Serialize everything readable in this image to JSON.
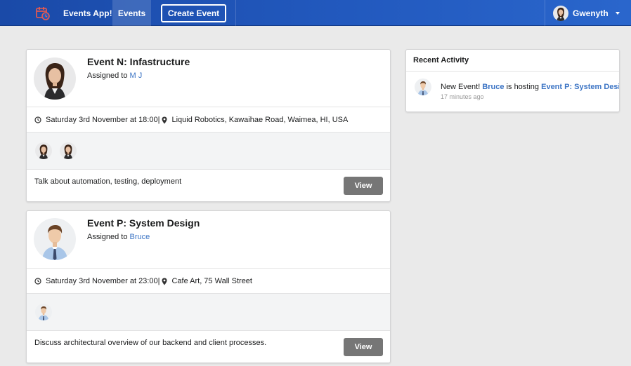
{
  "nav": {
    "brand": "Events App!",
    "events_tab": "Events",
    "create_button": "Create Event",
    "user_name": "Gwenyth",
    "brand_icon": "calendar-clock-icon"
  },
  "events": [
    {
      "title": "Event N: Infastructure",
      "assigned_prefix": "Assigned to",
      "assignee": "M J",
      "datetime": "Saturday 3rd November at 18:00|",
      "location": "Liquid Robotics, Kawaihae Road, Waimea, HI, USA",
      "description": "Talk about automation, testing, deployment",
      "view_label": "View"
    },
    {
      "title": "Event P: System Design",
      "assigned_prefix": "Assigned to",
      "assignee": "Bruce",
      "datetime": "Saturday 3rd November at 23:00|",
      "location": "Cafe Art, 75 Wall Street",
      "description": "Discuss architectural overview of our backend and client processes.",
      "view_label": "View"
    }
  ],
  "activity": {
    "header": "Recent Activity",
    "item": {
      "prefix": "New Event!",
      "user": "Bruce",
      "middle": "is hosting",
      "event": "Event P: System Design",
      "time": "17 minutes ago"
    }
  },
  "colors": {
    "nav_bg": "#2259be",
    "link": "#3a73c4",
    "button": "#767676",
    "page_bg": "#eaeaea"
  }
}
